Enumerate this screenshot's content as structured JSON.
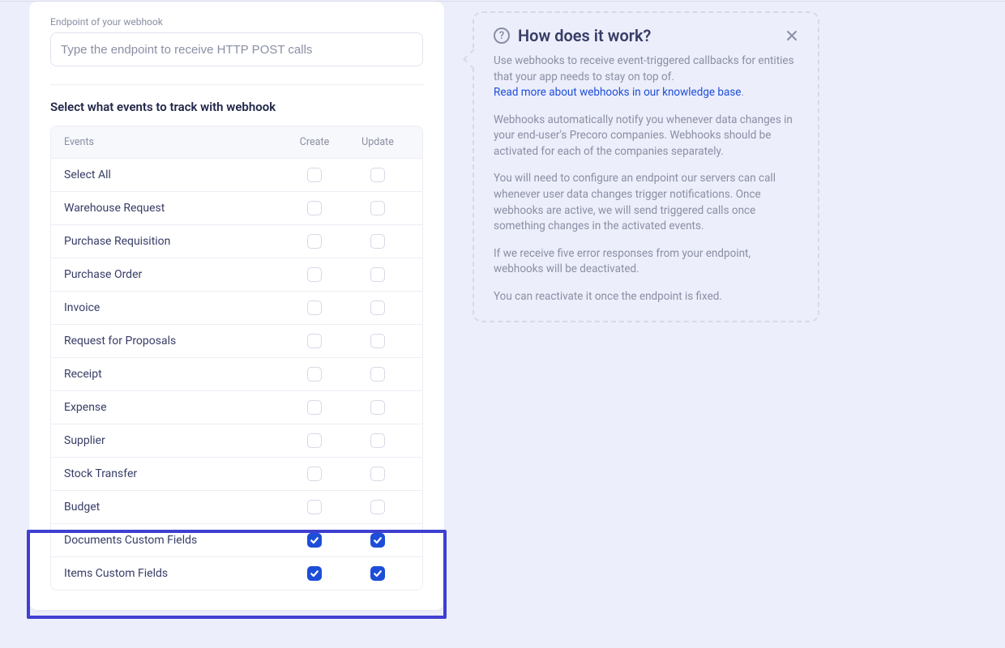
{
  "form": {
    "endpoint_label": "Endpoint of your webhook",
    "endpoint_placeholder": "Type the endpoint to receive HTTP POST calls",
    "section_title": "Select what events to track with webhook",
    "columns": {
      "events": "Events",
      "create": "Create",
      "update": "Update"
    },
    "rows": [
      {
        "label": "Select All",
        "create": false,
        "update": false
      },
      {
        "label": "Warehouse Request",
        "create": false,
        "update": false
      },
      {
        "label": "Purchase Requisition",
        "create": false,
        "update": false
      },
      {
        "label": "Purchase Order",
        "create": false,
        "update": false
      },
      {
        "label": "Invoice",
        "create": false,
        "update": false
      },
      {
        "label": "Request for Proposals",
        "create": false,
        "update": false
      },
      {
        "label": "Receipt",
        "create": false,
        "update": false
      },
      {
        "label": "Expense",
        "create": false,
        "update": false
      },
      {
        "label": "Supplier",
        "create": false,
        "update": false
      },
      {
        "label": "Stock Transfer",
        "create": false,
        "update": false
      },
      {
        "label": "Budget",
        "create": false,
        "update": false
      },
      {
        "label": "Documents Custom Fields",
        "create": true,
        "update": true
      },
      {
        "label": "Items Custom Fields",
        "create": true,
        "update": true
      }
    ]
  },
  "info": {
    "title": "How does it work?",
    "p1a": "Use webhooks to receive event-triggered callbacks for entities that your app needs to stay on top of.",
    "p1_link": "Read more about webhooks in our knowledge base",
    "p1_link_suffix": ".",
    "p2": "Webhooks automatically notify you whenever data changes in your end-user's Precoro companies. Webhooks should be activated for each of the companies separately.",
    "p3": "You will need to configure an endpoint our servers can call whenever user data changes trigger notifications. Once webhooks are active, we will send triggered calls once something changes in the activated events.",
    "p4": "If we receive five error responses from your endpoint, webhooks will be deactivated.",
    "p5": "You can reactivate it once the endpoint is fixed."
  }
}
